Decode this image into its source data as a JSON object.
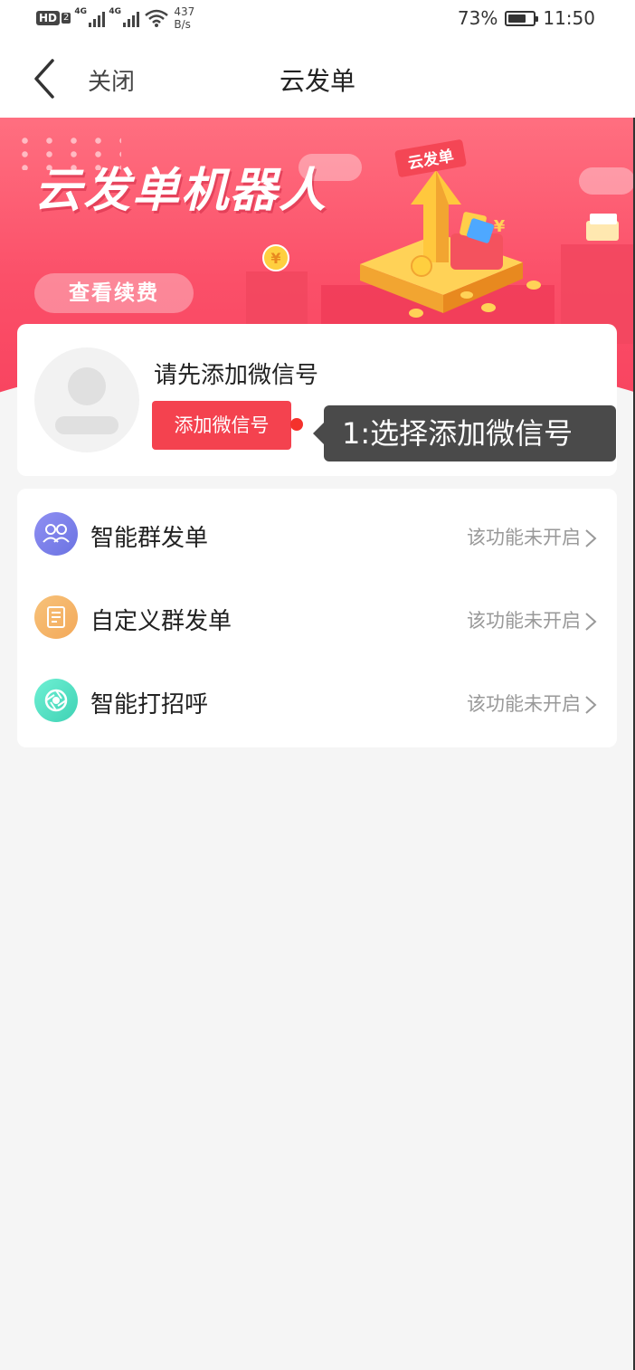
{
  "status_bar": {
    "hd": "HD",
    "hd_sub": "2",
    "net_type_1": "4G",
    "net_type_2": "4G",
    "net_speed_value": "437",
    "net_speed_unit": "B/s",
    "battery_percent": "73%",
    "battery_level": 0.73,
    "time": "11:50"
  },
  "nav": {
    "close_label": "关闭",
    "title": "云发单"
  },
  "banner": {
    "title": "云发单机器人",
    "renew_label": "查看续费",
    "tag": "云发单"
  },
  "account": {
    "prompt": "请先添加微信号",
    "add_button": "添加微信号"
  },
  "tooltip": {
    "text": "1:选择添加微信号"
  },
  "features": [
    {
      "label": "智能群发单",
      "status": "该功能未开启",
      "icon": "group-users-icon",
      "color": "#7b7fe8"
    },
    {
      "label": "自定义群发单",
      "status": "该功能未开启",
      "icon": "document-icon",
      "color": "#f4b86a"
    },
    {
      "label": "智能打招呼",
      "status": "该功能未开启",
      "icon": "aperture-icon",
      "color": "#4fdcc0"
    }
  ]
}
